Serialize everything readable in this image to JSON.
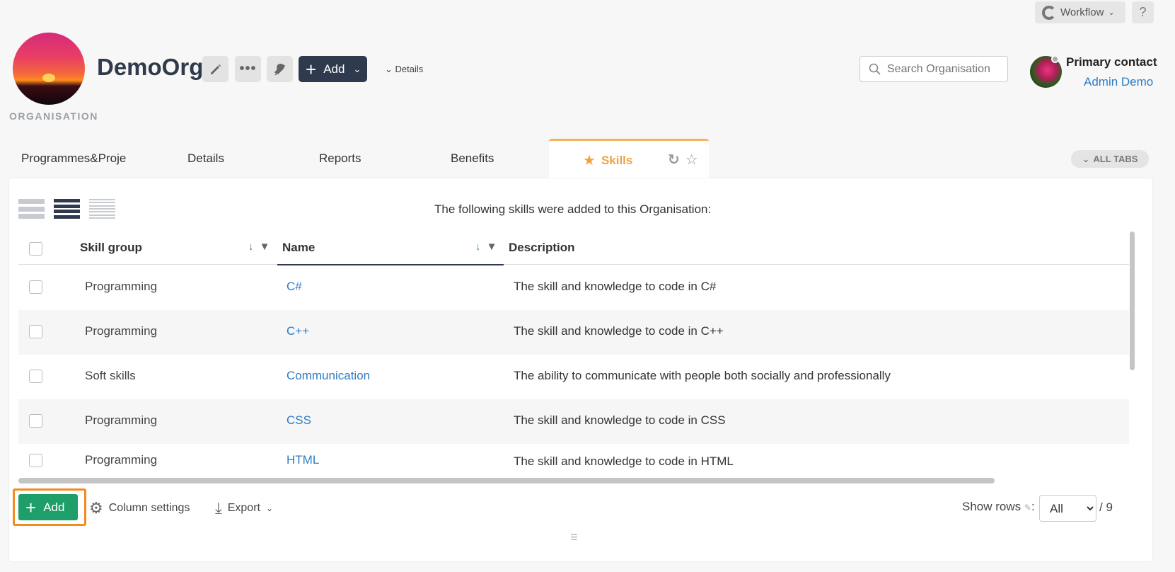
{
  "topbar": {
    "workflow_label": "Workflow",
    "help_label": "?"
  },
  "header": {
    "org_name": "DemoOrg",
    "org_caption": "ORGANISATION",
    "add_label": "Add",
    "details_label": "Details",
    "search_placeholder": "Search Organisation",
    "contact_label": "Primary contact",
    "contact_name": "Admin Demo"
  },
  "tabs": [
    {
      "label": "Programmes&Proje"
    },
    {
      "label": "Details"
    },
    {
      "label": "Reports"
    },
    {
      "label": "Benefits"
    },
    {
      "label": "Skills",
      "active": true
    }
  ],
  "all_tabs_label": "ALL TABS",
  "panel": {
    "intro": "The following skills were added to this Organisation:",
    "columns": {
      "group": "Skill group",
      "name": "Name",
      "description": "Description"
    },
    "rows": [
      {
        "group": "Programming",
        "name": "C#",
        "description": "The skill and knowledge to code in C#"
      },
      {
        "group": "Programming",
        "name": "C++",
        "description": "The skill and knowledge to code in C++"
      },
      {
        "group": "Soft skills",
        "name": "Communication",
        "description": "The ability to communicate with people both socially and professionally"
      },
      {
        "group": "Programming",
        "name": "CSS",
        "description": "The skill and knowledge to code in CSS"
      },
      {
        "group": "Programming",
        "name": "HTML",
        "description": "The skill and knowledge to code in HTML"
      }
    ]
  },
  "footer": {
    "add_label": "Add",
    "column_settings_label": "Column settings",
    "export_label": "Export",
    "show_rows_label": "Show rows",
    "show_rows_value": "All",
    "show_rows_options": [
      "All"
    ],
    "total": "/ 9"
  },
  "colors": {
    "accent_orange": "#f0a346",
    "add_green": "#1e9e69",
    "link_blue": "#2e7bc4",
    "dark_navy": "#2f3a4f",
    "highlight": "#f58a1f"
  }
}
